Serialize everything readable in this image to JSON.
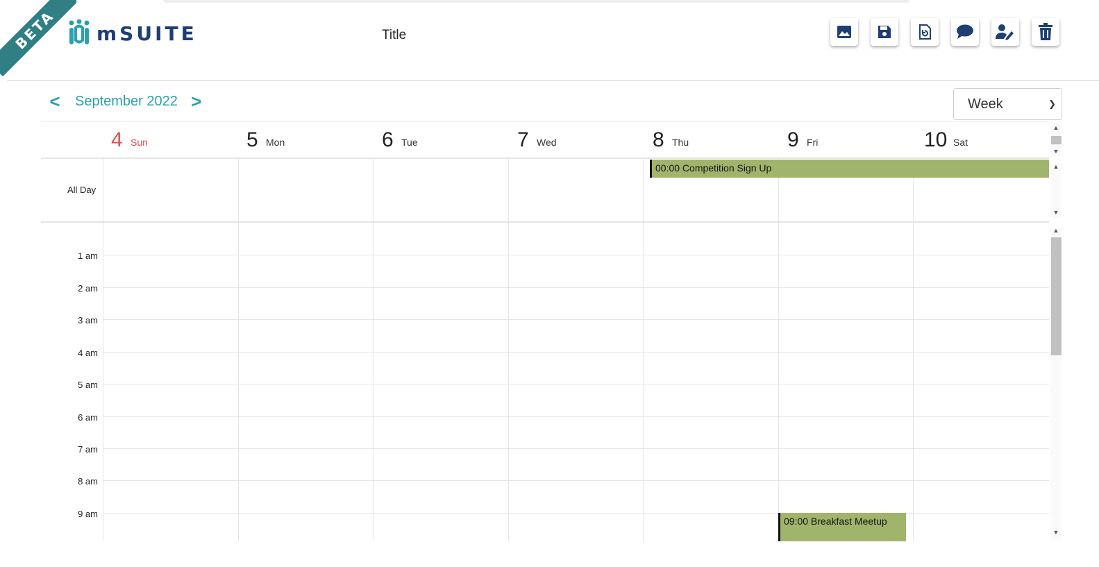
{
  "beta_label": "BETA",
  "logo": {
    "text": "mSUITE",
    "icon": "msuite-logo-icon"
  },
  "document": {
    "title": "Title"
  },
  "toolbar": {
    "buttons": [
      {
        "name": "image-button",
        "icon": "image-icon"
      },
      {
        "name": "save-button",
        "icon": "floppy-disk-icon"
      },
      {
        "name": "restore-button",
        "icon": "file-refresh-icon"
      },
      {
        "name": "comment-button",
        "icon": "speech-bubble-icon"
      },
      {
        "name": "edit-user-button",
        "icon": "user-edit-icon"
      },
      {
        "name": "delete-button",
        "icon": "trash-icon"
      }
    ],
    "icon_color": "#1f3f73"
  },
  "calendar": {
    "prev_label": "<",
    "next_label": ">",
    "month_label": "September 2022",
    "view_select": {
      "selected": "Week"
    },
    "days": [
      {
        "num": "4",
        "name": "Sun"
      },
      {
        "num": "5",
        "name": "Mon"
      },
      {
        "num": "6",
        "name": "Tue"
      },
      {
        "num": "7",
        "name": "Wed"
      },
      {
        "num": "8",
        "name": "Thu"
      },
      {
        "num": "9",
        "name": "Fri"
      },
      {
        "num": "10",
        "name": "Sat"
      }
    ],
    "allday_label": "All Day",
    "hours": [
      "1 am",
      "2 am",
      "3 am",
      "4 am",
      "5 am",
      "6 am",
      "7 am",
      "8 am",
      "9 am"
    ],
    "events": {
      "allday": {
        "label": "00:00 Competition Sign Up"
      },
      "timed": {
        "label": "09:00 Breakfast Meetup"
      }
    },
    "colors": {
      "accent": "#2aa0b4",
      "sunday": "#e74c4c",
      "event": "#a0b56b"
    }
  }
}
